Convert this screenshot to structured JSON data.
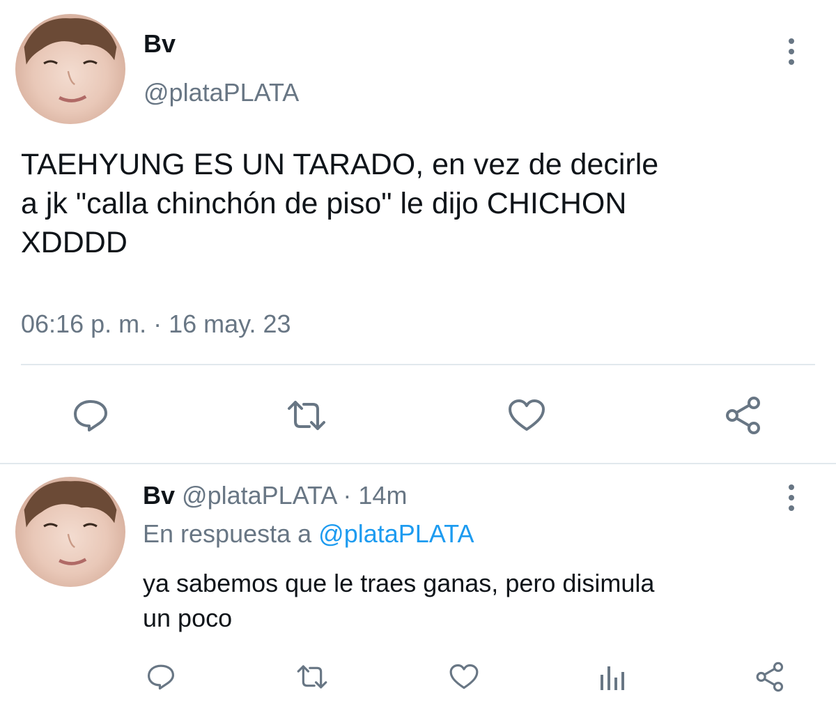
{
  "main_tweet": {
    "display_name": "Bv",
    "handle": "@plataPLATA",
    "text_line1": "TAEHYUNG ES UN TARADO, en vez de decirle",
    "text_line2": "a jk \"calla chinchón de piso\" le dijo CHICHON",
    "text_line3": "XDDDD",
    "timestamp": "06:16 p. m. · 16 may. 23",
    "actions": [
      "reply-icon",
      "retweet-icon",
      "like-icon",
      "share-icon"
    ]
  },
  "reply_tweet": {
    "display_name": "Bv",
    "handle": "@plataPLATA",
    "separator": "·",
    "age": "14m",
    "in_reply_prefix": "En respuesta a",
    "in_reply_handle": "@plataPLATA",
    "text_line1": "ya sabemos que le traes ganas, pero disimula",
    "text_line2": "un poco",
    "actions": [
      "reply-icon",
      "retweet-icon",
      "like-icon",
      "analytics-icon",
      "share-icon"
    ]
  },
  "colors": {
    "text": "#0f1419",
    "muted": "#687684",
    "link": "#1d9bf0",
    "divider": "#e1e8ed"
  }
}
